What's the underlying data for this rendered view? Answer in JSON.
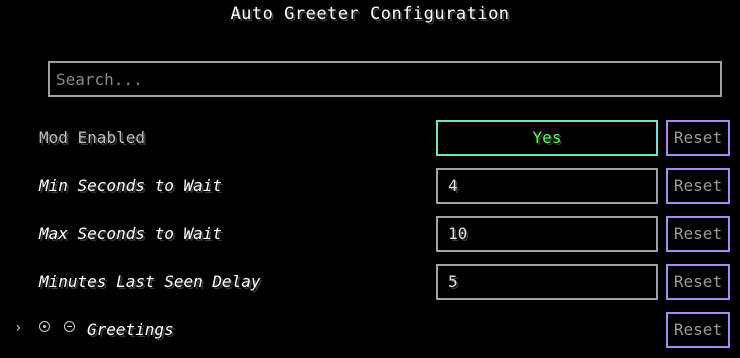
{
  "window": {
    "title": "Auto Greeter Configuration"
  },
  "search": {
    "placeholder": "Search...",
    "value": ""
  },
  "reset_label": "Reset",
  "settings": [
    {
      "label": "Mod Enabled",
      "value": "Yes"
    },
    {
      "label": "Min Seconds to Wait",
      "value": "4"
    },
    {
      "label": "Max Seconds to Wait",
      "value": "10"
    },
    {
      "label": "Minutes Last Seen Delay",
      "value": "5"
    }
  ],
  "group": {
    "expand_icon": "chevron-right-icon",
    "add_icon": "add-circle-icon",
    "remove_icon": "remove-circle-icon",
    "label": "Greetings"
  },
  "colors": {
    "toggle_border": "#6fe3c7",
    "toggle_value": "#55ff55",
    "reset_border": "#a98ce8",
    "field_border": "#a0a0a0"
  }
}
